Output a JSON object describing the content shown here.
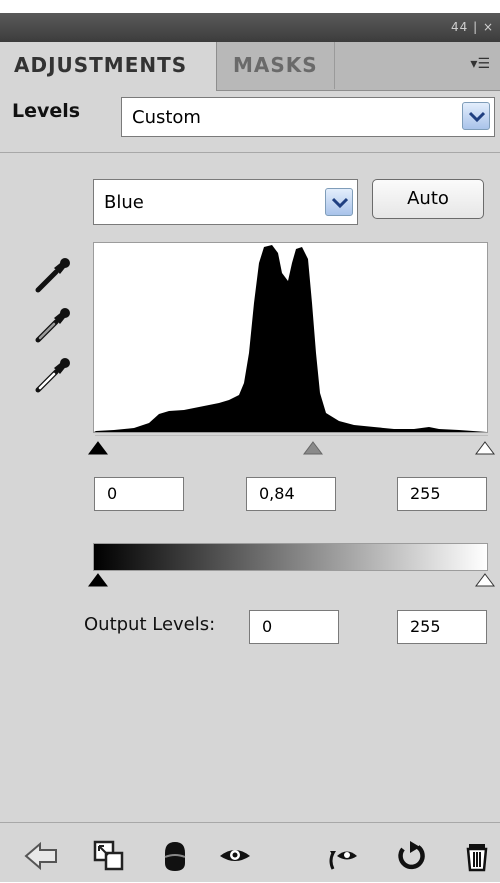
{
  "panel": {
    "tabs": [
      {
        "label": "ADJUSTMENTS",
        "active": true
      },
      {
        "label": "MASKS",
        "active": false
      }
    ],
    "titlebar_controls": "44 | ×"
  },
  "levels": {
    "label": "Levels",
    "preset": "Custom"
  },
  "channel": {
    "selected": "Blue",
    "auto_label": "Auto"
  },
  "eyedroppers": [
    "black-point-eyedropper-icon",
    "gray-point-eyedropper-icon",
    "white-point-eyedropper-icon"
  ],
  "input_levels": {
    "black": "0",
    "gamma": "0,84",
    "white": "255"
  },
  "output_levels": {
    "label": "Output Levels:",
    "black": "0",
    "white": "255"
  },
  "bottom_toolbar": [
    "back-arrow-icon",
    "clip-to-layer-icon",
    "mask-visibility-icon",
    "eye-icon",
    "view-previous-state-icon",
    "reset-icon",
    "trash-icon"
  ],
  "colors": {
    "panel_bg": "#d6d6d6",
    "tab_bar_bg": "#b8b8b8",
    "chevron_blue": "#4a6fb0"
  }
}
